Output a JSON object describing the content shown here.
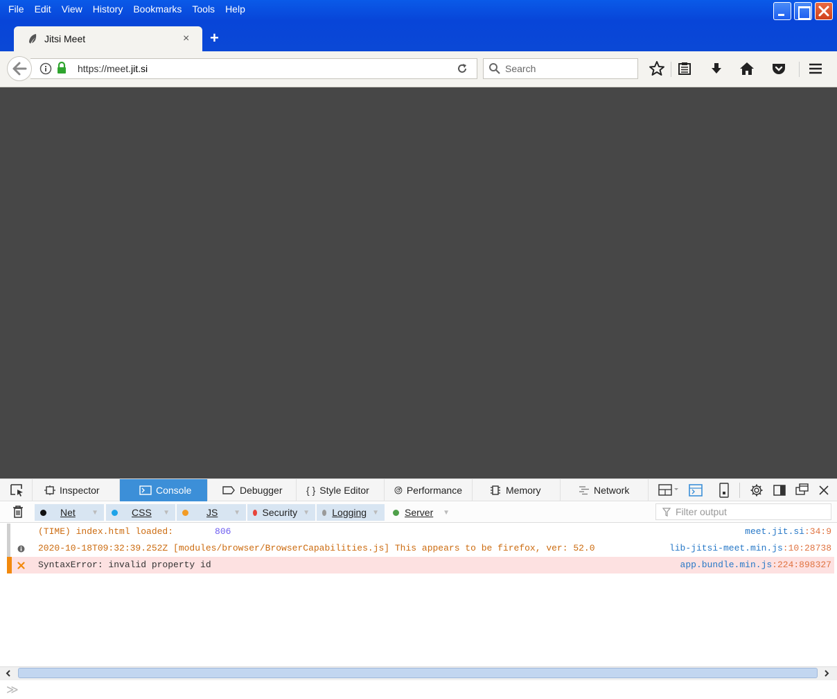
{
  "menu": [
    "File",
    "Edit",
    "View",
    "History",
    "Bookmarks",
    "Tools",
    "Help"
  ],
  "tab": {
    "title": "Jitsi Meet",
    "close": "×",
    "new_tab": "+"
  },
  "navbar": {
    "url_prefix": "https://meet.",
    "url_domain": "jit.si",
    "search_placeholder": "Search"
  },
  "devtools": {
    "tabs": [
      "Inspector",
      "Console",
      "Debugger",
      "Style Editor",
      "Performance",
      "Memory",
      "Network"
    ],
    "active_tab": "Console",
    "filters": [
      {
        "label": "Net",
        "color": "#111111"
      },
      {
        "label": "CSS",
        "color": "#1ea3e8"
      },
      {
        "label": "JS",
        "color": "#f29b25"
      },
      {
        "label": "Security",
        "color": "#e8443a"
      },
      {
        "label": "Logging",
        "color": "#9a9a9a"
      },
      {
        "label": "Server",
        "color": "#4fa04a"
      }
    ],
    "filter_placeholder": "Filter output",
    "log": [
      {
        "message": "(TIME) index.html loaded:",
        "value": "806",
        "source": "meet.jit.si",
        "line": ":34:9"
      },
      {
        "message": "2020-10-18T09:32:39.252Z [modules/browser/BrowserCapabilities.js] This appears to be firefox, ver: 52.0",
        "source": "lib-jitsi-meet.min.js",
        "line": ":10:28738"
      },
      {
        "message": "SyntaxError: invalid property id",
        "source": "app.bundle.min.js",
        "line": ":224:898327"
      }
    ],
    "prompt": "≫"
  }
}
